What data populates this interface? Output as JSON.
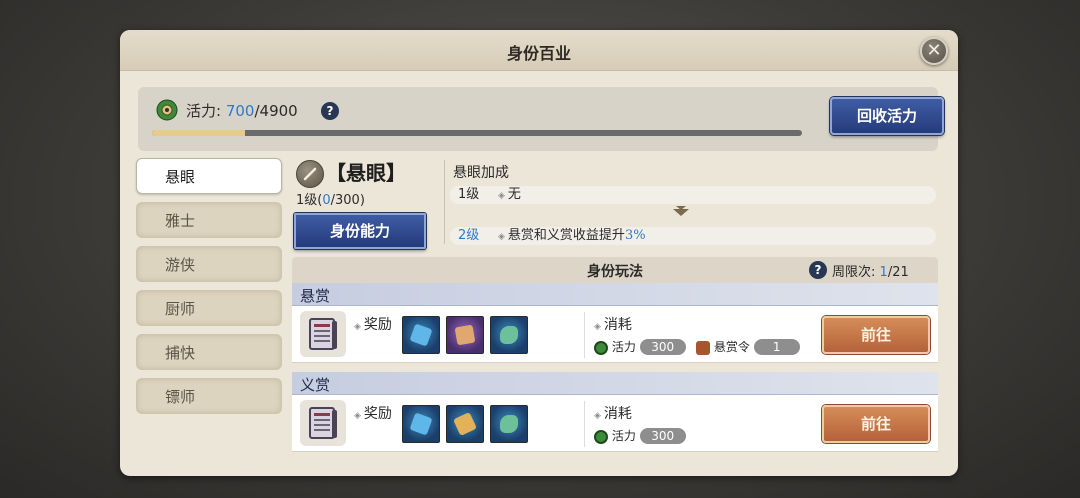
{
  "window": {
    "title": "身份百业",
    "close_icon": "close-icon"
  },
  "vitality": {
    "label": "活力:",
    "current": "700",
    "max": "/4900",
    "progress_fraction": 0.143,
    "recover_button": "回收活力",
    "help_icon": "?"
  },
  "tabs": [
    {
      "label": "悬眼",
      "active": true
    },
    {
      "label": "雅士",
      "active": false
    },
    {
      "label": "游侠",
      "active": false
    },
    {
      "label": "厨师",
      "active": false
    },
    {
      "label": "捕快",
      "active": false
    },
    {
      "label": "镖师",
      "active": false
    }
  ],
  "identity": {
    "name": "【悬眼】",
    "level_prefix": "1级(",
    "level_current": "0",
    "level_suffix": "/300)",
    "ability_button": "身份能力"
  },
  "bonus": {
    "title": "悬眼加成",
    "rows": [
      {
        "level": "1级",
        "text": "无",
        "highlight": ""
      },
      {
        "level": "2级",
        "text": "悬赏和义赏收益提升",
        "highlight": "3%"
      }
    ]
  },
  "gameplay": {
    "title": "身份玩法",
    "weekly_label": "周限次:",
    "weekly_current": "1",
    "weekly_max": "/21",
    "sections": [
      {
        "name": "悬赏",
        "reward_label": "奖励",
        "cost_label": "消耗",
        "costs": [
          {
            "name": "活力",
            "value": "300"
          },
          {
            "name": "悬赏令",
            "value": "1"
          }
        ],
        "go_button": "前往"
      },
      {
        "name": "义赏",
        "reward_label": "奖励",
        "cost_label": "消耗",
        "costs": [
          {
            "name": "活力",
            "value": "300"
          }
        ],
        "go_button": "前往"
      }
    ]
  },
  "colors": {
    "accent_blue": "#2f79c9",
    "button_blue": "#2d4588",
    "button_orange": "#c4744a"
  }
}
